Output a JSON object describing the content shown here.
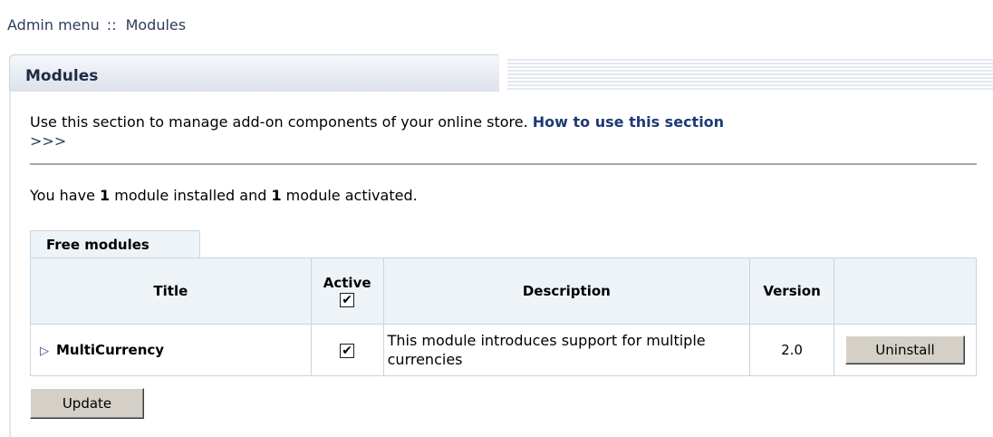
{
  "breadcrumb": {
    "root": "Admin menu",
    "separator": "::",
    "current": "Modules"
  },
  "section": {
    "title": "Modules"
  },
  "intro": {
    "text": "Use this section to manage add-on components of your online store. ",
    "link": "How to use this section",
    "arrow": ">>>"
  },
  "summary": {
    "prefix": "You have ",
    "installed_count": "1",
    "middle": " module installed and ",
    "activated_count": "1",
    "suffix": " module activated."
  },
  "free_modules_tab": "Free modules",
  "table": {
    "headers": {
      "title": "Title",
      "active": "Active",
      "description": "Description",
      "version": "Version"
    },
    "rows": [
      {
        "title": "MultiCurrency",
        "active": true,
        "description": "This module introduces support for multiple currencies",
        "version": "2.0",
        "action": "Uninstall"
      }
    ]
  },
  "buttons": {
    "update": "Update"
  },
  "colors": {
    "link": "#1f3a73",
    "header_bg": "#eef3f8",
    "border": "#c5d6e3"
  }
}
